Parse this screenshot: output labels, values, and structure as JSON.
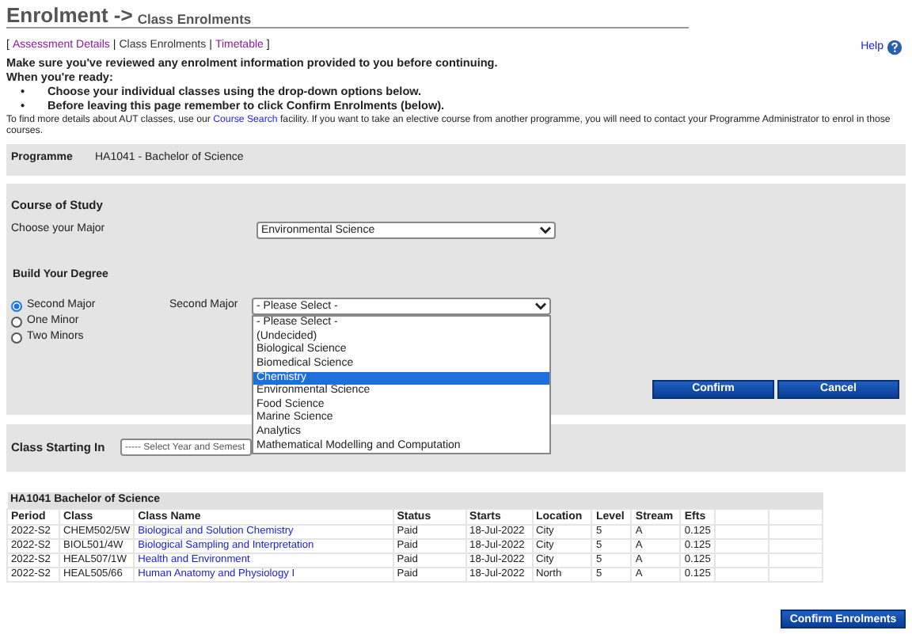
{
  "header": {
    "title": "Enrolment ->",
    "subtitle": "Class Enrolments"
  },
  "breadcrumb": {
    "open": "[",
    "close": "]",
    "separator": "|",
    "items": [
      {
        "label": "Assessment Details",
        "selected": false
      },
      {
        "label": "Class Enrolments",
        "selected": true
      },
      {
        "label": "Timetable",
        "selected": false
      }
    ]
  },
  "help": {
    "label": "Help"
  },
  "instructions": {
    "lines": [
      "Make sure you've reviewed any enrolment information provided to you before continuing.",
      "When you're ready:"
    ],
    "bullet": "•",
    "bullets": [
      "Choose your individual classes using the drop-down options below.",
      "Before leaving this page remember to click Confirm Enrolments (below)."
    ],
    "note_before": "To find more details about AUT classes, use our",
    "note_link": "Course Search",
    "note_after": "facility. If you want to take an elective course from another programme, you will need to contact your Programme Administrator to enrol in those courses."
  },
  "programme": {
    "label": "Programme",
    "value": "HA1041 - Bachelor of Science"
  },
  "course_of_study": {
    "heading": "Course of Study",
    "major_label": "Choose your Major",
    "major_value": "Environmental Science"
  },
  "build_degree": {
    "heading": "Build Your Degree",
    "options": [
      {
        "label": "Second Major",
        "selected": true
      },
      {
        "label": "One Minor",
        "selected": false
      },
      {
        "label": "Two Minors",
        "selected": false
      }
    ],
    "select_label": "Second Major",
    "select_value": "- Please Select -",
    "dropdown_options": [
      {
        "label": "- Please Select -",
        "selected": false
      },
      {
        "label": "(Undecided)",
        "selected": false
      },
      {
        "label": "Biological Science",
        "selected": false
      },
      {
        "label": "Biomedical Science",
        "selected": false
      },
      {
        "label": "Chemistry",
        "selected": true
      },
      {
        "label": "Environmental Science",
        "selected": false
      },
      {
        "label": "Food Science",
        "selected": false
      },
      {
        "label": "Marine Science",
        "selected": false
      },
      {
        "label": "Analytics",
        "selected": false
      },
      {
        "label": "Mathematical Modelling and Computation",
        "selected": false
      }
    ],
    "buttons": [
      "Confirm",
      "Cancel"
    ]
  },
  "class_starting": {
    "label": "Class Starting In",
    "select_value": "----- Select Year and Semest"
  },
  "table": {
    "title": "HA1041 Bachelor of Science",
    "columns": [
      "Period",
      "Class",
      "Class Name",
      "Status",
      "Starts",
      "Location",
      "Level",
      "Stream",
      "Efts"
    ],
    "rows": [
      [
        "2022-S2",
        "CHEM502/5W",
        "Biological and Solution Chemistry",
        "Paid",
        "18-Jul-2022",
        "City",
        "5",
        "A",
        "0.125"
      ],
      [
        "2022-S2",
        "BIOL501/4W",
        "Biological Sampling and Interpretation",
        "Paid",
        "18-Jul-2022",
        "City",
        "5",
        "A",
        "0.125"
      ],
      [
        "2022-S2",
        "HEAL507/1W",
        "Health and Environment",
        "Paid",
        "18-Jul-2022",
        "City",
        "5",
        "A",
        "0.125"
      ],
      [
        "2022-S2",
        "HEAL505/66",
        "Human Anatomy and Physiology I",
        "Paid",
        "18-Jul-2022",
        "North",
        "5",
        "A",
        "0.125"
      ]
    ]
  },
  "confirm_enrolments": "Confirm Enrolments"
}
